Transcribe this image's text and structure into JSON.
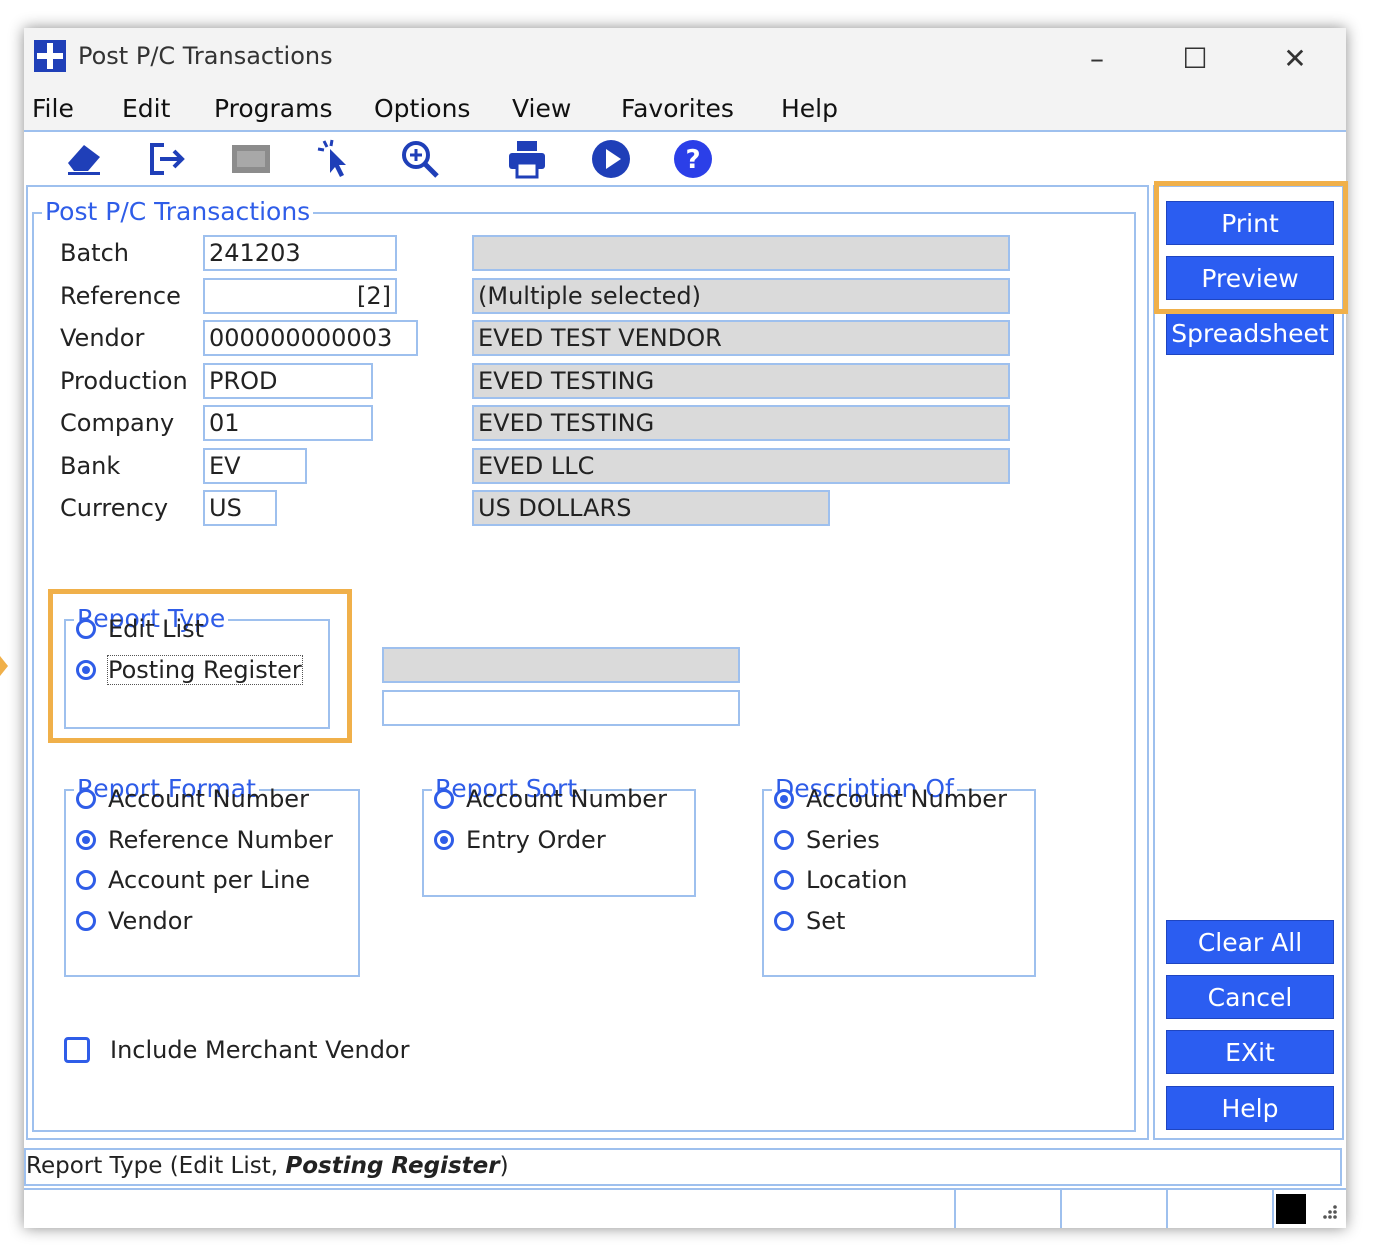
{
  "window": {
    "title": "Post P/C Transactions",
    "controls": {
      "minimize": "–",
      "maximize": "☐",
      "close": "✕"
    }
  },
  "menu": [
    "File",
    "Edit",
    "Programs",
    "Options",
    "View",
    "Favorites",
    "Help"
  ],
  "toolbar": [
    "eraser-icon",
    "exit-icon",
    "screen-icon",
    "pointer-icon",
    "zoom-icon",
    "print-icon",
    "play-icon",
    "help-icon"
  ],
  "main": {
    "group_title": "Post P/C Transactions",
    "fields": [
      {
        "label": "Batch",
        "value": "241203",
        "desc": ""
      },
      {
        "label": "Reference",
        "value": "[2]",
        "desc": "(Multiple selected)"
      },
      {
        "label": "Vendor",
        "value": "000000000003",
        "desc": "EVED TEST VENDOR"
      },
      {
        "label": "Production",
        "value": "PROD",
        "desc": "EVED TESTING"
      },
      {
        "label": "Company",
        "value": "01",
        "desc": "EVED TESTING"
      },
      {
        "label": "Bank",
        "value": "EV",
        "desc": "EVED LLC"
      },
      {
        "label": "Currency",
        "value": "US",
        "desc": "US DOLLARS"
      }
    ],
    "report_type": {
      "title": "Report Type",
      "options": [
        "Edit List",
        "Posting Register"
      ],
      "selected": 1
    },
    "report_type_extra_fields": [
      "",
      ""
    ],
    "report_format": {
      "title": "Report Format",
      "options": [
        "Account Number",
        "Reference Number",
        "Account per Line",
        "Vendor"
      ],
      "selected": 1
    },
    "report_sort": {
      "title": "Report Sort",
      "options": [
        "Account Number",
        "Entry Order"
      ],
      "selected": 1
    },
    "description_of": {
      "title": "Description Of",
      "options": [
        "Account Number",
        "Series",
        "Location",
        "Set"
      ],
      "selected": 0
    },
    "checkbox": {
      "label": "Include Merchant Vendor",
      "checked": false
    }
  },
  "side_buttons_top": [
    "Print",
    "Preview",
    "Spreadsheet"
  ],
  "side_buttons_bottom": [
    "Clear All",
    "Cancel",
    "EXit",
    "Help"
  ],
  "status": {
    "prefix": "Report Type (",
    "option1": "Edit List, ",
    "option2": "Posting Register",
    "suffix": ")"
  },
  "colors": {
    "accent": "#2b5df1",
    "border": "#9ec0ee",
    "highlight": "#f0b04a",
    "readonly": "#dadada"
  }
}
